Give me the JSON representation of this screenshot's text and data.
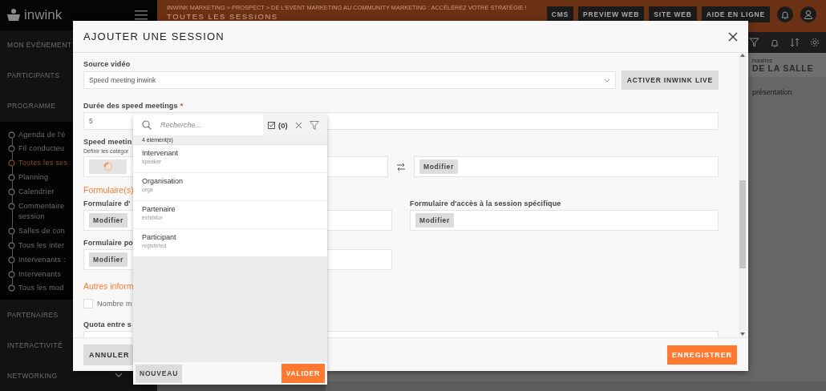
{
  "topbar": {
    "logo": "inwink",
    "breadcrumb": "INWINK MARKETING > PROSPECT > DE L'EVENT MARKETING AU COMMUNITY MARKETING : ACCÉLÉREZ VOTRE STRATÉGIE !",
    "page_title": "TOUTES LES SESSIONS",
    "buttons": [
      "CMS",
      "PREVIEW WEB",
      "SITE WEB",
      "AIDE EN LIGNE"
    ]
  },
  "sidebar": {
    "sections": [
      {
        "label": "MON ÉVÉNEMENT"
      },
      {
        "label": "PARTICIPANTS"
      },
      {
        "label": "PROGRAMME",
        "children": [
          {
            "lines": [
              "Agenda de l'é"
            ],
            "selected": false
          },
          {
            "lines": [
              "Fil conducteu"
            ],
            "selected": false
          },
          {
            "lines": [
              "Toutes les ses"
            ],
            "selected": true
          },
          {
            "lines": [
              "Planning"
            ],
            "selected": false
          },
          {
            "lines": [
              "Calendrier"
            ],
            "selected": false
          },
          {
            "lines": [
              "Commentaire",
              "session"
            ],
            "selected": false
          },
          {
            "lines": [
              "Salles de con"
            ],
            "selected": false
          },
          {
            "lines": [
              "Tous les inter"
            ],
            "selected": false
          },
          {
            "lines": [
              "Intervenants :"
            ],
            "selected": false
          },
          {
            "lines": [
              "Intervenants"
            ],
            "selected": false
          },
          {
            "lines": [
              "Tous les mod"
            ],
            "selected": false
          }
        ]
      },
      {
        "label": "PARTENAIRES"
      },
      {
        "label": "INTERACTIVITÉ"
      },
      {
        "label": "NETWORKING",
        "expandable": true
      }
    ]
  },
  "background_panel": {
    "caption": "horaires",
    "title": "DE LA SALLE",
    "text": "présentation"
  },
  "modal": {
    "title": "AJOUTER UNE SESSION",
    "video_source": {
      "label": "Source vidéo",
      "value": "Speed meeting inwink",
      "button": "ACTIVER INWINK LIVE"
    },
    "duration": {
      "label": "Durée des speed meetings",
      "required_mark": "*",
      "value": "5"
    },
    "categories": {
      "label": "Speed meetin",
      "hint": "Définir les catégor",
      "loading": true,
      "button": "Modifier"
    },
    "forms_heading": "Formulaire(s)",
    "forms": [
      {
        "label": "Formulaire d'",
        "button": "Modifier"
      },
      {
        "label": "Formulaire d'accès à la session spécifique",
        "button": "Modifier"
      },
      {
        "label": "Formulaire po",
        "button": "Modifier"
      }
    ],
    "other_heading": "Autres inform",
    "max_option": {
      "label": "Nombre m",
      "checked": false
    },
    "quota": {
      "label": "Quota entre s"
    },
    "cancel_button": "ANNULER",
    "save_button": "ENREGISTRER"
  },
  "picker": {
    "search": {
      "placeholder": "Recherche..."
    },
    "selected_count": "(0)",
    "count_label": "4 élément(s)",
    "items": [
      {
        "name": "Intervenant",
        "code": "speaker",
        "selected": false
      },
      {
        "name": "Organisation",
        "code": "orga",
        "selected": false
      },
      {
        "name": "Partenaire",
        "code": "exhibitor",
        "selected": false
      },
      {
        "name": "Participant",
        "code": "registered",
        "selected": false
      }
    ],
    "new_button": "NOUVEAU",
    "validate_button": "VALIDER"
  }
}
